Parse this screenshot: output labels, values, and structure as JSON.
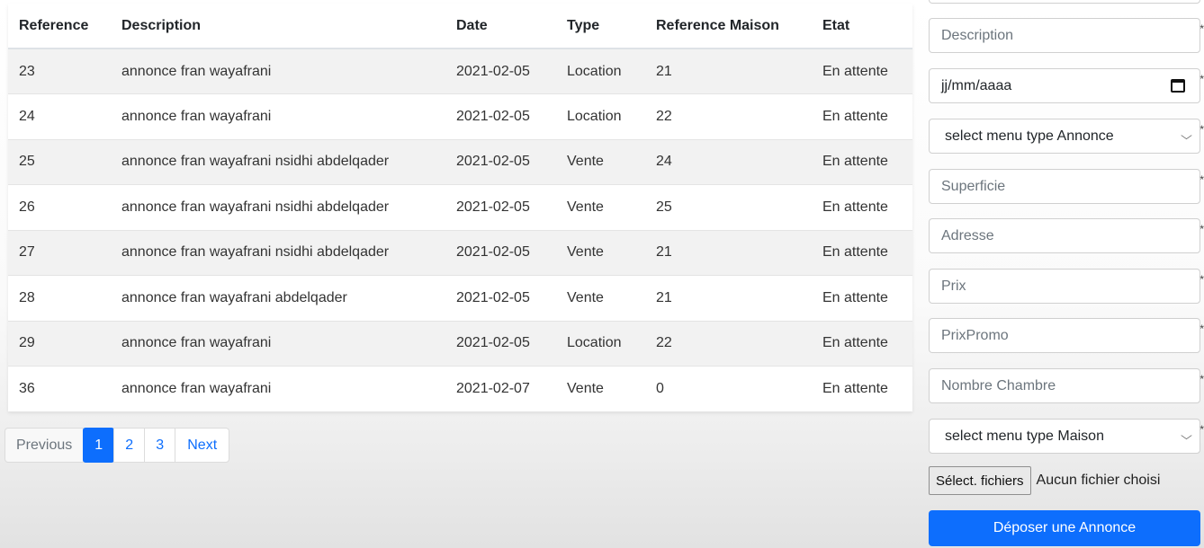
{
  "table": {
    "columns": [
      "Reference",
      "Description",
      "Date",
      "Type",
      "Reference Maison",
      "Etat"
    ],
    "rows": [
      {
        "reference": "23",
        "description": "annonce fran wayafrani",
        "date": "2021-02-05",
        "type": "Location",
        "reference_maison": "21",
        "etat": "En attente"
      },
      {
        "reference": "24",
        "description": "annonce fran wayafrani",
        "date": "2021-02-05",
        "type": "Location",
        "reference_maison": "22",
        "etat": "En attente"
      },
      {
        "reference": "25",
        "description": "annonce fran wayafrani nsidhi abdelqader",
        "date": "2021-02-05",
        "type": "Vente",
        "reference_maison": "24",
        "etat": "En attente"
      },
      {
        "reference": "26",
        "description": "annonce fran wayafrani nsidhi abdelqader",
        "date": "2021-02-05",
        "type": "Vente",
        "reference_maison": "25",
        "etat": "En attente"
      },
      {
        "reference": "27",
        "description": "annonce fran wayafrani nsidhi abdelqader",
        "date": "2021-02-05",
        "type": "Vente",
        "reference_maison": "21",
        "etat": "En attente"
      },
      {
        "reference": "28",
        "description": "annonce fran wayafrani abdelqader",
        "date": "2021-02-05",
        "type": "Vente",
        "reference_maison": "21",
        "etat": "En attente"
      },
      {
        "reference": "29",
        "description": "annonce fran wayafrani",
        "date": "2021-02-05",
        "type": "Location",
        "reference_maison": "22",
        "etat": "En attente"
      },
      {
        "reference": "36",
        "description": "annonce fran wayafrani",
        "date": "2021-02-07",
        "type": "Vente",
        "reference_maison": "0",
        "etat": "En attente"
      }
    ]
  },
  "pagination": {
    "previous": "Previous",
    "pages": [
      "1",
      "2",
      "3"
    ],
    "active": "1",
    "next": "Next"
  },
  "form": {
    "description_placeholder": "Description",
    "date_placeholder": "jj/mm/aaaa",
    "type_annonce_select": "select menu type Annonce",
    "superficie_placeholder": "Superficie",
    "adresse_placeholder": "Adresse",
    "prix_placeholder": "Prix",
    "prixpromo_placeholder": "PrixPromo",
    "nombre_chambre_placeholder": "Nombre Chambre",
    "type_maison_select": "select menu type Maison",
    "file_button": "Sélect. fichiers",
    "file_status": "Aucun fichier choisi",
    "submit": "Déposer une Annonce",
    "required_mark": "*"
  },
  "colors": {
    "primary": "#0d6efd",
    "stripe": "#f2f2f2"
  }
}
